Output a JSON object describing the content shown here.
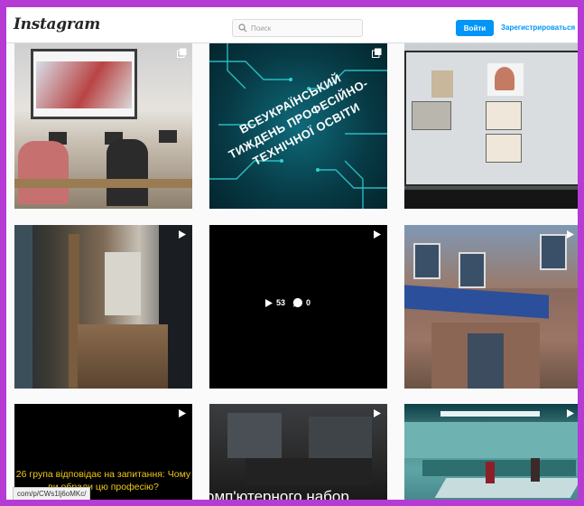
{
  "header": {
    "logo": "Instagram",
    "search_placeholder": "Поиск",
    "login_label": "Войти",
    "signup_label": "Зарегистрироваться"
  },
  "tiles": [
    {
      "kind": "carousel-icon"
    },
    {
      "kind": "carousel-icon",
      "caption": "ВСЕУКРАЇНСЬКИЙ ТИЖДЕНЬ ПРОФЕСІЙНО-ТЕХНІЧНОЇ ОСВІТИ"
    },
    {
      "kind": "none"
    },
    {
      "kind": "video-icon"
    },
    {
      "kind": "video-icon",
      "likes": "53",
      "comments": "0"
    },
    {
      "kind": "video-icon"
    },
    {
      "kind": "video-icon",
      "caption": "26 група відповідає на запитання: Чому ви обрали цю професію?"
    },
    {
      "kind": "video-icon",
      "caption": "омп'ютерного набор"
    },
    {
      "kind": "video-icon"
    }
  ],
  "status_bar": {
    "url": "com/p/CWs1lj6oMKc/"
  }
}
